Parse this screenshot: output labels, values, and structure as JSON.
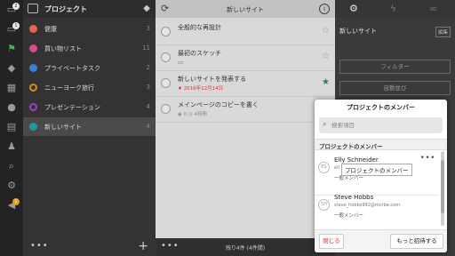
{
  "rail": {
    "icons": [
      "inbox-icon",
      "inbox-icon",
      "flag-icon",
      "tag-icon",
      "calendar-icon",
      "monitor-icon",
      "chat-icon",
      "reports-icon",
      "people-icon",
      "search-icon",
      "gear-icon",
      "megaphone-icon"
    ],
    "badges": {
      "first": "2",
      "second": "1",
      "announce": "1"
    }
  },
  "projects": {
    "title": "プロジェクト",
    "items": [
      {
        "name": "健康",
        "count": "3",
        "color": "#e8654b"
      },
      {
        "name": "買い物リスト",
        "count": "11",
        "color": "#d94b8a"
      },
      {
        "name": "プライベートタスク",
        "count": "2",
        "color": "#3b7fd6"
      },
      {
        "name": "ニューヨーク旅行",
        "count": "3",
        "color": "#e08a1e"
      },
      {
        "name": "プレゼンテーション",
        "count": "4",
        "color": "#9b3fc6"
      },
      {
        "name": "新しいサイト",
        "count": "4",
        "color": "#1e9a98"
      }
    ]
  },
  "tasks": {
    "title": "新しいサイト",
    "items": [
      {
        "name": "全般的な再設計",
        "meta": "",
        "date": ""
      },
      {
        "name": "最初のスケッチ",
        "meta": "",
        "date": ""
      },
      {
        "name": "新しいサイトを発表する",
        "meta": "",
        "date": "2016年12月14日"
      },
      {
        "name": "メインページのコピーを書く",
        "meta": "0",
        "date": "4時間"
      }
    ],
    "footer": "残り4件 (4件間)"
  },
  "detail": {
    "project_name": "新しいサイト",
    "edit": "編集",
    "filter": "フィルター",
    "autosort": "自動並び"
  },
  "popover": {
    "title": "プロジェクトのメンバー",
    "search_placeholder": "検索項目",
    "section": "プロジェクトのメンバー",
    "members": [
      {
        "name": "Elly Schneider",
        "email": "ell",
        "role": "一般メンバー",
        "initials": "ES"
      },
      {
        "name": "Steve Hobbs",
        "email": "steve_hobbs992@mcrbe.com",
        "role": "一般メンバー",
        "initials": "SH"
      }
    ],
    "tooltip": "プロジェクトのメンバー",
    "close": "閉じる",
    "invite": "もっと招待する"
  }
}
